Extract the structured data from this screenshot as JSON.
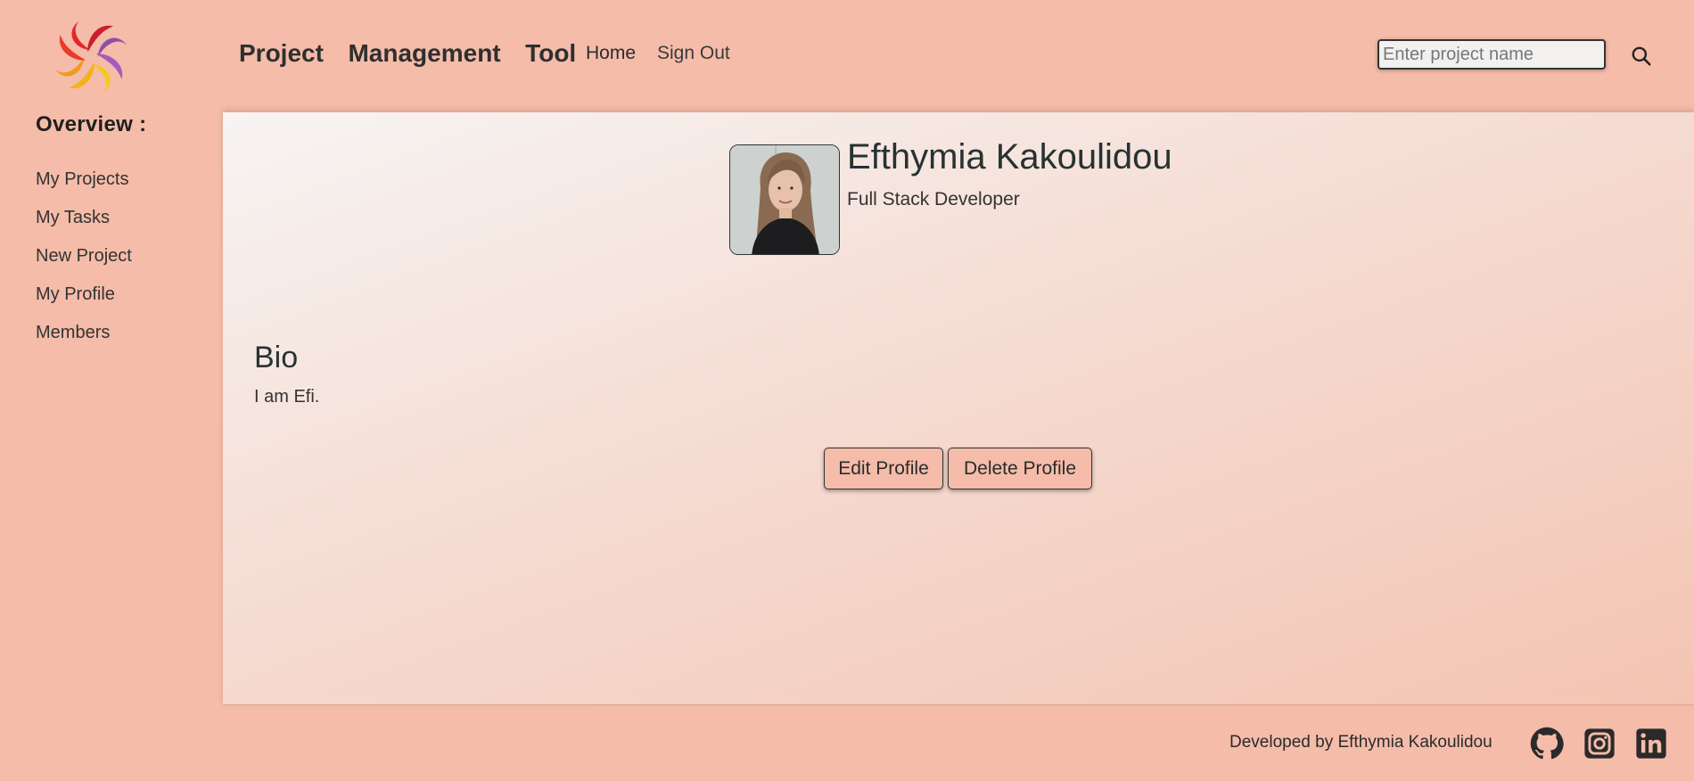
{
  "header": {
    "brand": "Project  Management  Tool",
    "nav": {
      "home": "Home",
      "sign_out": "Sign Out"
    },
    "search": {
      "placeholder": "Enter project name",
      "value": ""
    }
  },
  "sidebar": {
    "title": "Overview :",
    "items": [
      {
        "label": "My Projects"
      },
      {
        "label": "My Tasks"
      },
      {
        "label": "New Project"
      },
      {
        "label": "My Profile"
      },
      {
        "label": "Members"
      }
    ]
  },
  "profile": {
    "name": "Efthymia Kakoulidou",
    "role": "Full Stack Developer",
    "bio_heading": "Bio",
    "bio_text": "I am Efi.",
    "edit_label": "Edit Profile",
    "delete_label": "Delete Profile"
  },
  "footer": {
    "credit": "Developed by Efthymia Kakoulidou",
    "icons": [
      "github-icon",
      "instagram-icon",
      "linkedin-icon"
    ]
  },
  "colors": {
    "background": "#f4bca9",
    "panel_light": "#f7f4f3",
    "text_dark": "#273232",
    "logo_red": "#e3262b",
    "logo_purple": "#8e4fa6",
    "logo_orange": "#f29a1e",
    "logo_yellow": "#f7c81c"
  }
}
